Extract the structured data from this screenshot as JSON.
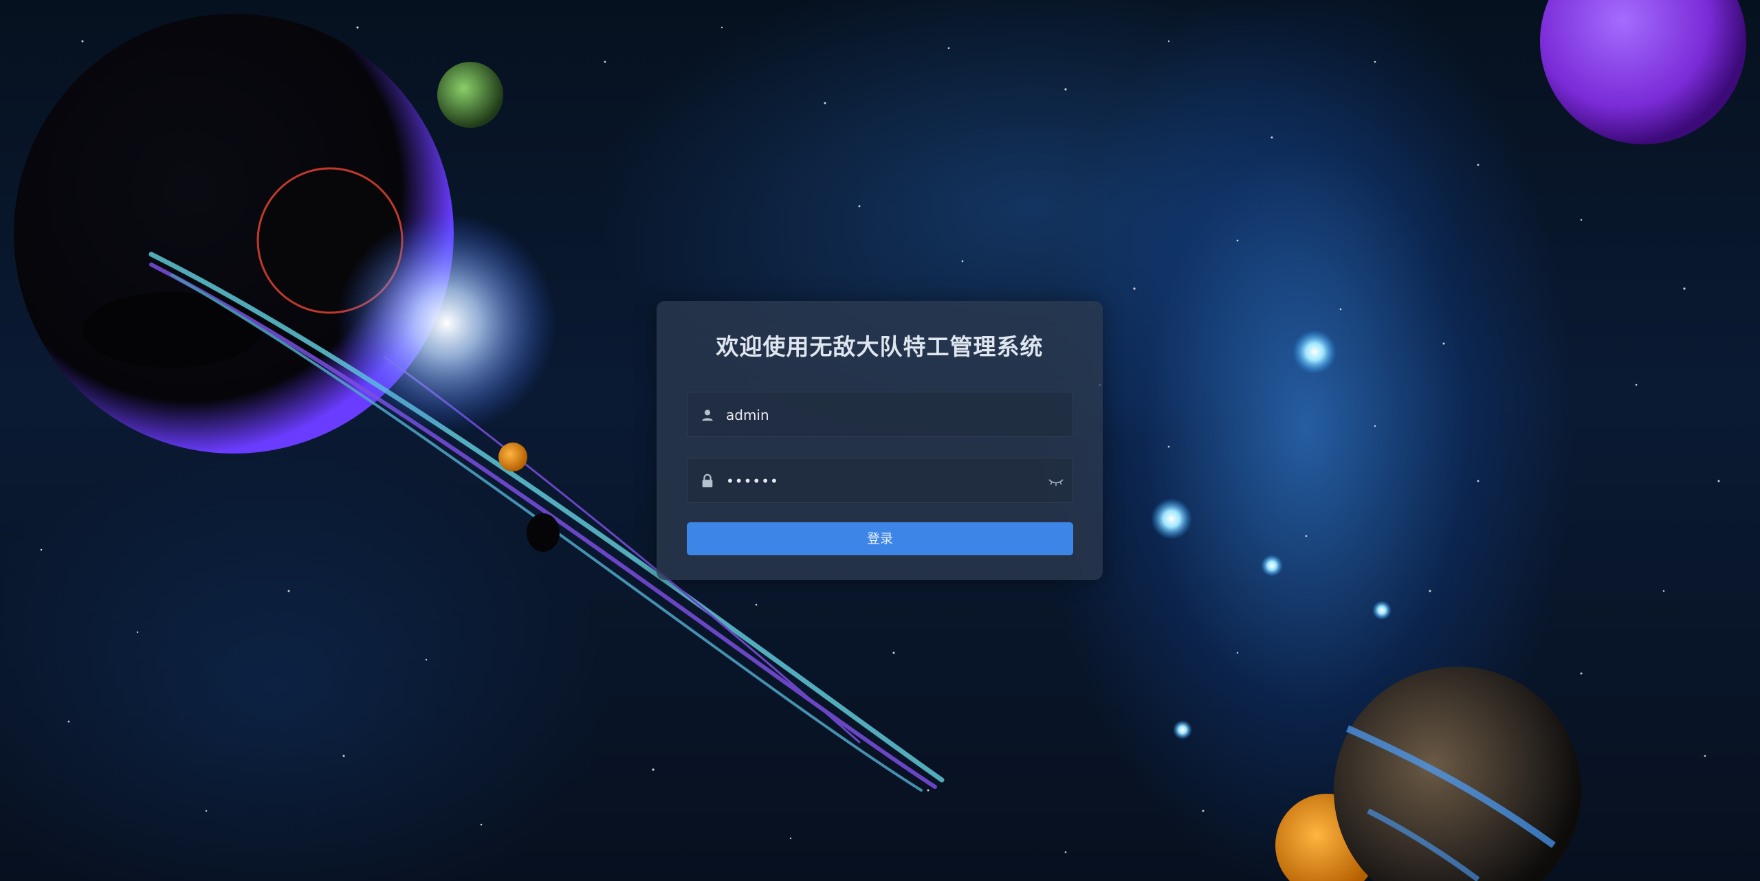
{
  "login": {
    "title": "欢迎使用无敌大队特工管理系统",
    "username_value": "admin",
    "password_value": "••••••",
    "submit_label": "登录"
  },
  "icons": {
    "username": "user-icon",
    "password": "lock-icon",
    "toggle_password": "eye-closed-icon"
  },
  "colors": {
    "panel_bg": "#2c3a50",
    "button_bg": "#3d86e8",
    "title_text": "#dfe6f0"
  }
}
